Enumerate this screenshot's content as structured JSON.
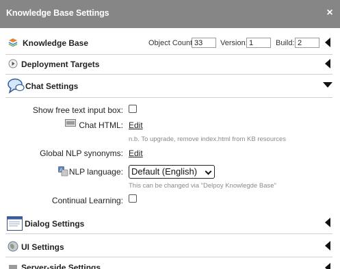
{
  "window": {
    "title": "Knowledge Base Settings",
    "close_glyph": "×"
  },
  "knowledge_base": {
    "title": "Knowledge Base",
    "object_count_label": "Object Count:",
    "object_count_value": "33",
    "version_label": "Version:",
    "version_value": "1",
    "build_label": "Build:",
    "build_value": "2"
  },
  "sections": {
    "deployment_targets": "Deployment Targets",
    "chat_settings": "Chat Settings",
    "dialog_settings": "Dialog Settings",
    "ui_settings": "UI Settings",
    "server_side_settings": "Server-side Settings"
  },
  "chat": {
    "free_text_label": "Show free text input box:",
    "chat_html_label": "Chat HTML:",
    "chat_html_link": "Edit",
    "chat_html_note": "n.b. To upgrade, remove index.html from KB resources",
    "nlp_synonyms_label": "Global NLP synonyms:",
    "nlp_synonyms_link": "Edit",
    "nlp_language_label": "NLP language:",
    "nlp_language_value": "Default (English)",
    "nlp_language_note": "This can be changed via \"Delpoy Knowlegde Base\"",
    "continual_learning_label": "Continual Learning:"
  },
  "colors": {
    "titlebar": "#868686",
    "divider": "#d0d0d0",
    "note_text": "#8a8a8a"
  },
  "icons": {
    "knowledge_base": "kb-icon",
    "deployment": "play-circle-icon",
    "chat": "speech-bubble-icon",
    "chat_html": "html-file-icon",
    "nlp_language": "language-icon",
    "dialog": "window-icon",
    "ui": "globe-icon",
    "server": "server-icon"
  }
}
